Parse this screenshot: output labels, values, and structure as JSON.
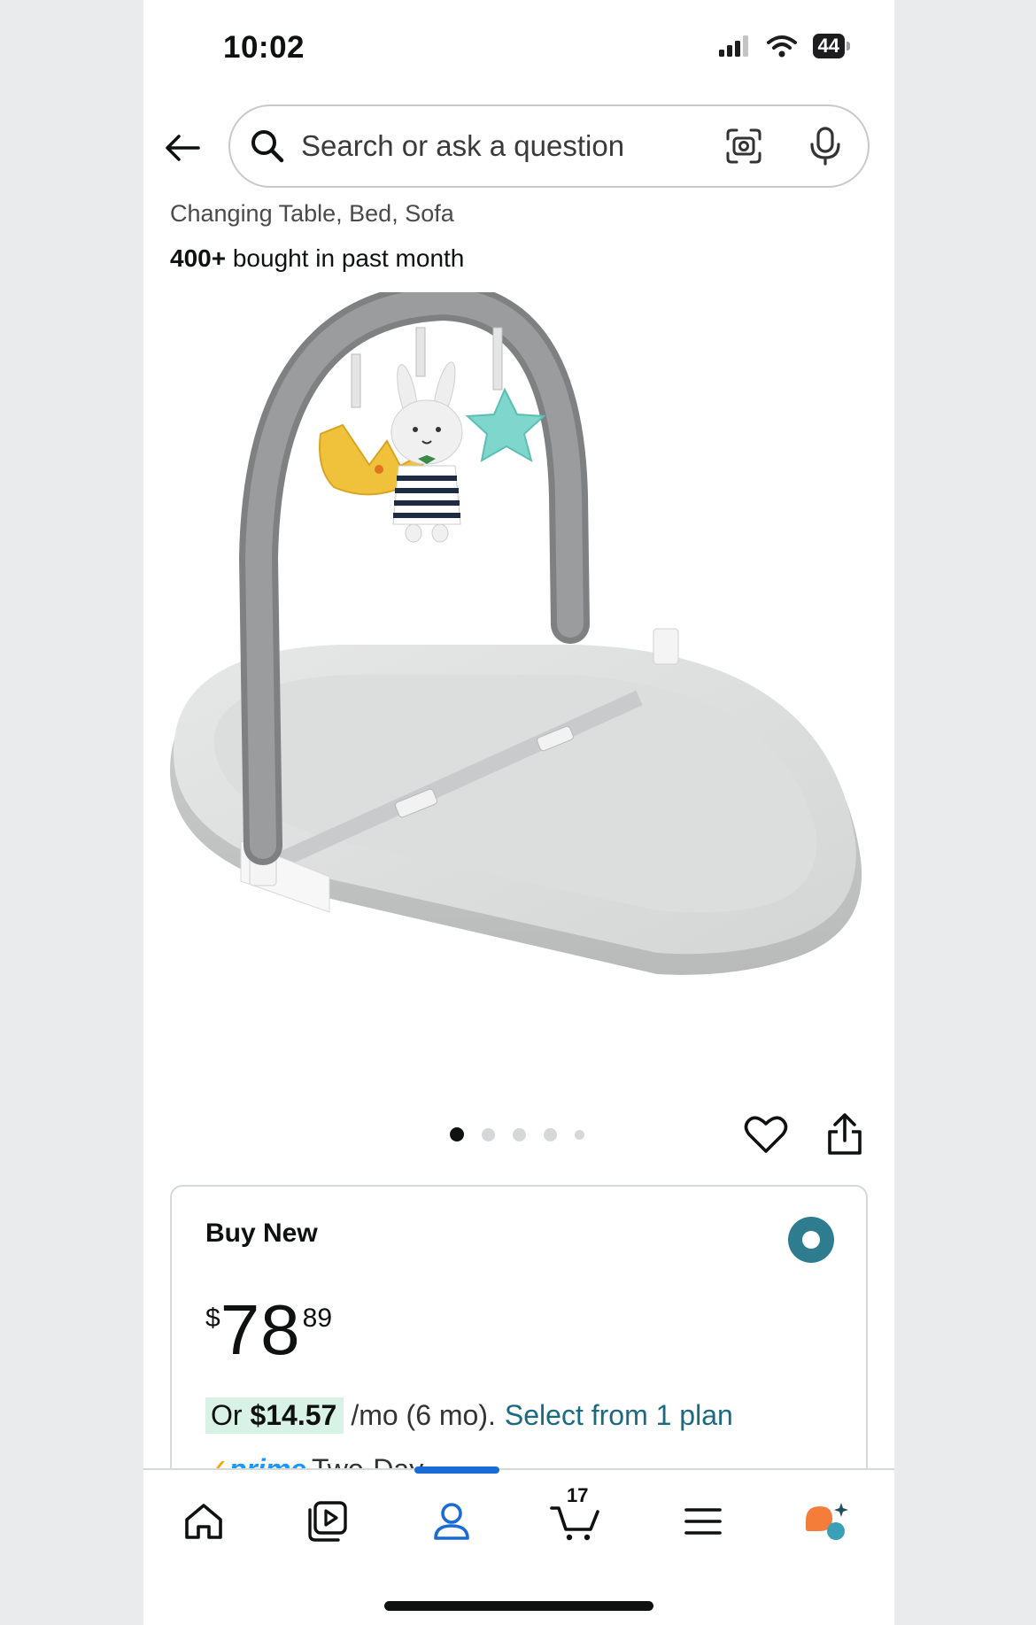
{
  "status_bar": {
    "time": "10:02",
    "battery": "44"
  },
  "search": {
    "placeholder": "Search or ask a question"
  },
  "product": {
    "subtitle": "Changing Table, Bed, Sofa",
    "bought_count": "400+",
    "bought_suffix": " bought in past month",
    "carousel": {
      "count": 5,
      "active_index": 0
    }
  },
  "buy_box": {
    "title": "Buy New",
    "price": {
      "currency": "$",
      "whole": "78",
      "fraction": "89"
    },
    "installment": {
      "prefix": "Or ",
      "amount": "$14.57",
      "terms": "/mo (6 mo).",
      "link": "Select from 1 plan"
    },
    "prime": {
      "logo": "prime",
      "check": "✓",
      "delivery": "Two-Day"
    }
  },
  "bottom_nav": {
    "items": [
      "home-icon",
      "video-icon",
      "account-icon",
      "cart-icon",
      "menu-icon",
      "rufus-icon"
    ],
    "active": "account-icon",
    "cart_count": "17"
  },
  "colors": {
    "accent": "#1a6b82",
    "radio": "#2e7d8f",
    "prime": "#1a98ff",
    "nav_active": "#1a6bd6",
    "installment_bg": "#d9f2e6"
  }
}
